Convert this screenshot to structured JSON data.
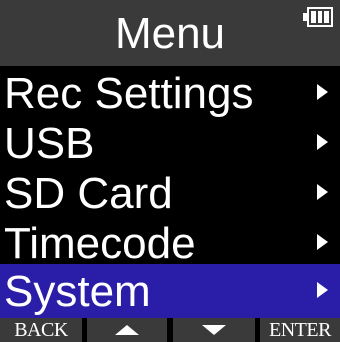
{
  "header": {
    "title": "Menu",
    "battery_icon": "battery-icon",
    "battery_level": 1.0
  },
  "menu": {
    "items": [
      {
        "label": "Rec Settings",
        "icon": "chevron-right-icon"
      },
      {
        "label": "USB",
        "icon": "chevron-right-icon"
      },
      {
        "label": "SD Card",
        "icon": "chevron-right-icon"
      },
      {
        "label": "Timecode",
        "icon": "chevron-right-icon"
      },
      {
        "label": "System",
        "icon": "chevron-right-icon",
        "selected": true
      }
    ]
  },
  "softkeys": {
    "back": "BACK",
    "up_icon": "up-arrow-icon",
    "down_icon": "down-arrow-icon",
    "enter": "ENTER"
  },
  "colors": {
    "background": "#000000",
    "title_bar": "#3a3a3a",
    "selection": "#2a1ea8",
    "text": "#ffffff"
  }
}
